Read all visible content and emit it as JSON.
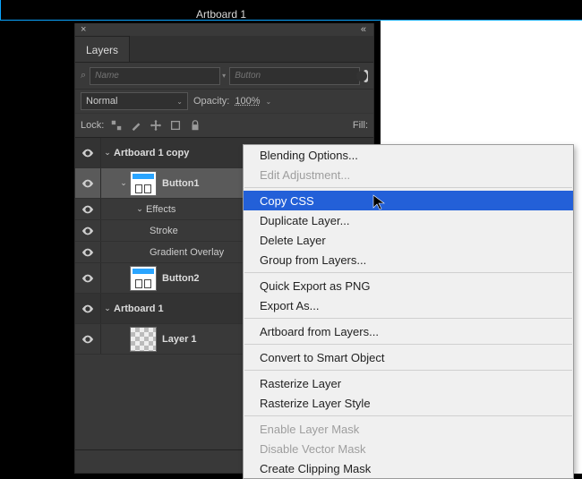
{
  "canvas": {
    "title": "Artboard 1"
  },
  "panel": {
    "tab": "Layers",
    "filter_name_placeholder": "Name",
    "filter_text_placeholder": "Button",
    "blend_mode": "Normal",
    "opacity_label": "Opacity:",
    "opacity_value": "100%",
    "lock_label": "Lock:",
    "fill_label": "Fill:"
  },
  "lock_icons": [
    "transparency-icon",
    "brush-icon",
    "move-icon",
    "crop-icon",
    "lock-icon"
  ],
  "layers": [
    {
      "type": "artboard",
      "name": "Artboard 1 copy",
      "eye": true,
      "open": true
    },
    {
      "type": "layer",
      "name": "Button1",
      "eye": true,
      "open": true,
      "selected": true,
      "thumb": "button"
    },
    {
      "type": "fxhead",
      "name": "Effects",
      "eye": true,
      "open": true
    },
    {
      "type": "fx",
      "name": "Stroke",
      "eye": true
    },
    {
      "type": "fx",
      "name": "Gradient Overlay",
      "eye": true
    },
    {
      "type": "layer",
      "name": "Button2",
      "eye": true,
      "thumb": "button"
    },
    {
      "type": "artboard",
      "name": "Artboard 1",
      "eye": true,
      "open": true
    },
    {
      "type": "layer",
      "name": "Layer 1",
      "eye": true,
      "thumb": "checker"
    }
  ],
  "bottom_icons": [
    "link-icon",
    "fx-icon",
    "mask-icon"
  ],
  "context_menu": {
    "groups": [
      [
        {
          "label": "Blending Options...",
          "enabled": true
        },
        {
          "label": "Edit Adjustment...",
          "enabled": false
        }
      ],
      [
        {
          "label": "Copy CSS",
          "enabled": true,
          "highlight": true
        },
        {
          "label": "Duplicate Layer...",
          "enabled": true
        },
        {
          "label": "Delete Layer",
          "enabled": true
        },
        {
          "label": "Group from Layers...",
          "enabled": true
        }
      ],
      [
        {
          "label": "Quick Export as PNG",
          "enabled": true
        },
        {
          "label": "Export As...",
          "enabled": true
        }
      ],
      [
        {
          "label": "Artboard from Layers...",
          "enabled": true
        }
      ],
      [
        {
          "label": "Convert to Smart Object",
          "enabled": true
        }
      ],
      [
        {
          "label": "Rasterize Layer",
          "enabled": true
        },
        {
          "label": "Rasterize Layer Style",
          "enabled": true
        }
      ],
      [
        {
          "label": "Enable Layer Mask",
          "enabled": false
        },
        {
          "label": "Disable Vector Mask",
          "enabled": false
        },
        {
          "label": "Create Clipping Mask",
          "enabled": true
        }
      ]
    ]
  }
}
